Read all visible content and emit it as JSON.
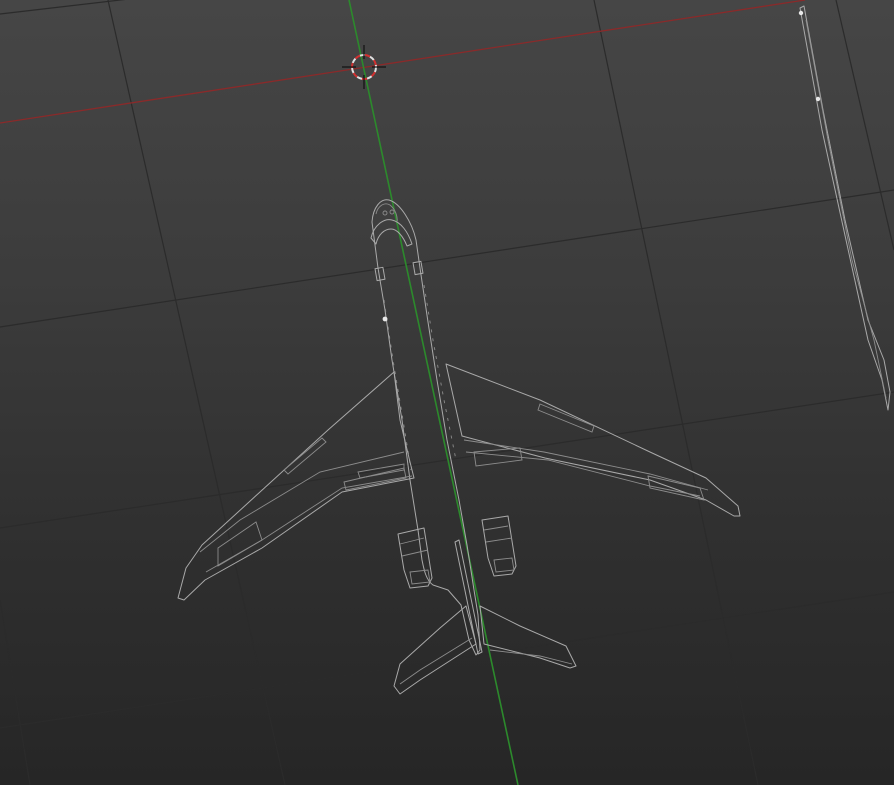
{
  "viewport": {
    "background_top": "#464646",
    "background_bottom": "#262626",
    "grid_color": "#2b2b2b",
    "x_axis_color": "#8a2a2a",
    "y_axis_color": "#2c8a2c",
    "wire_color": "#a9a9a9",
    "cursor_colors": [
      "#e0e0e0",
      "#d23030"
    ]
  },
  "objects": [
    {
      "type": "aircraft-wireframe",
      "view": "top"
    },
    {
      "type": "side-profile-wireframe",
      "view": "edge-on"
    }
  ],
  "icons": [
    "3d-cursor-icon",
    "selected-vertex-icon"
  ]
}
